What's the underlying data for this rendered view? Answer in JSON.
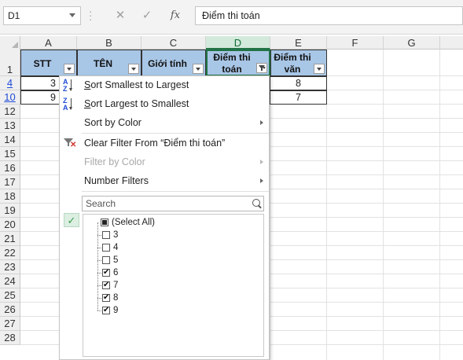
{
  "name_box": "D1",
  "formula_bar": {
    "cancel_glyph": "✕",
    "confirm_glyph": "✓",
    "fx_label": "fx",
    "content": "Điểm thi toán"
  },
  "columns": [
    "A",
    "B",
    "C",
    "D",
    "E",
    "F",
    "G"
  ],
  "selected_column": "D",
  "row_numbers": [
    {
      "n": "1",
      "filtered": false
    },
    {
      "n": "4",
      "filtered": true
    },
    {
      "n": "10",
      "filtered": true
    },
    {
      "n": "12",
      "filtered": false
    },
    {
      "n": "13",
      "filtered": false
    },
    {
      "n": "14",
      "filtered": false
    },
    {
      "n": "15",
      "filtered": false
    },
    {
      "n": "16",
      "filtered": false
    },
    {
      "n": "17",
      "filtered": false
    },
    {
      "n": "18",
      "filtered": false
    },
    {
      "n": "19",
      "filtered": false
    },
    {
      "n": "20",
      "filtered": false
    },
    {
      "n": "21",
      "filtered": false
    },
    {
      "n": "22",
      "filtered": false
    },
    {
      "n": "23",
      "filtered": false
    },
    {
      "n": "24",
      "filtered": false
    },
    {
      "n": "25",
      "filtered": false
    },
    {
      "n": "26",
      "filtered": false
    },
    {
      "n": "27",
      "filtered": false
    },
    {
      "n": "28",
      "filtered": false
    }
  ],
  "table_headers": {
    "A": "STT",
    "B": "TÊN",
    "C": "Giới tính",
    "D_line1": "Điểm thi",
    "D_line2": "toán",
    "E_line1": "Điểm thi",
    "E_line2": "văn"
  },
  "rows": [
    {
      "A": "3",
      "E": "8"
    },
    {
      "A": "9",
      "E": "7"
    }
  ],
  "filter_menu": {
    "sort_asc": "Sort Smallest to Largest",
    "sort_desc": "Sort Largest to Smallest",
    "sort_by_color": "Sort by Color",
    "clear_filter": "Clear Filter From “Điểm thi toán”",
    "filter_by_color": "Filter by Color",
    "number_filters": "Number Filters",
    "search_placeholder": "Search",
    "select_all": "(Select All)",
    "values": [
      {
        "label": "3",
        "checked": false
      },
      {
        "label": "4",
        "checked": false
      },
      {
        "label": "5",
        "checked": false
      },
      {
        "label": "6",
        "checked": true
      },
      {
        "label": "7",
        "checked": true
      },
      {
        "label": "8",
        "checked": true
      },
      {
        "label": "9",
        "checked": true
      }
    ]
  },
  "colors": {
    "header_fill": "#a8c6e6",
    "excel_green": "#217346",
    "filtered_row_number": "#1f4bd6"
  }
}
